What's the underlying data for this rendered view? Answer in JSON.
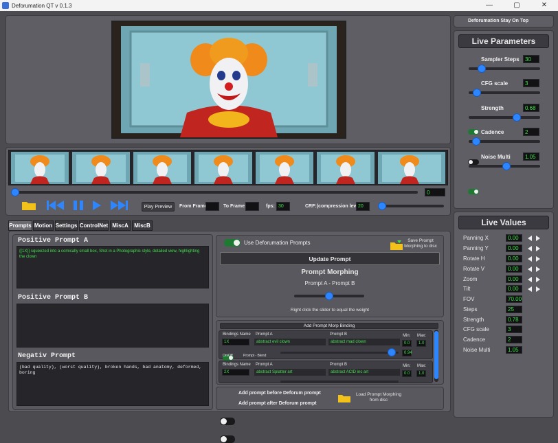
{
  "window": {
    "title": "Deforumation QT v 0.1.3",
    "minimize": "—",
    "maximize": "▢",
    "close": "✕"
  },
  "topbar": {
    "stay_on_top_label": "Deforumation Stay On Top"
  },
  "live_parameters": {
    "title": "Live Parameters",
    "items": [
      {
        "label": "Sampler Steps",
        "value": "30",
        "has_toggle": false,
        "slider_pct": 14
      },
      {
        "label": "CFG scale",
        "value": "3",
        "has_toggle": true,
        "toggle_on": true,
        "slider_pct": 6
      },
      {
        "label": "Strength",
        "value": "0.68",
        "has_toggle": true,
        "toggle_on": false,
        "slider_pct": 68
      },
      {
        "label": "Cadence",
        "value": "2",
        "has_toggle": true,
        "toggle_on": true,
        "slider_pct": 5
      },
      {
        "label": "Noise Multi",
        "value": "1.05",
        "has_toggle": true,
        "toggle_on": true,
        "slider_pct": 52
      }
    ]
  },
  "live_values": {
    "title": "Live Values",
    "items": [
      {
        "label": "Panning X",
        "value": "0.00",
        "arrows": true
      },
      {
        "label": "Panning Y",
        "value": "0.00",
        "arrows": true
      },
      {
        "label": "Rotate H",
        "value": "0.00",
        "arrows": true
      },
      {
        "label": "Rotate V",
        "value": "0.00",
        "arrows": true
      },
      {
        "label": "Zoom",
        "value": "0.00",
        "arrows": true
      },
      {
        "label": "Tilt",
        "value": "0.00",
        "arrows": true
      },
      {
        "label": "FOV",
        "value": "70.00",
        "arrows": false
      },
      {
        "label": "Steps",
        "value": "25",
        "arrows": false
      },
      {
        "label": "Strength",
        "value": "0.78",
        "arrows": false
      },
      {
        "label": "CFG scale",
        "value": "3",
        "arrows": false
      },
      {
        "label": "Cadence",
        "value": "2",
        "arrows": false
      },
      {
        "label": "Noise Multi",
        "value": "1.05",
        "arrows": false
      }
    ]
  },
  "playback": {
    "timeline_value": "0",
    "timeline_pct": 0,
    "play_preview": "Play Preview",
    "from_frame_label": "From Frame:",
    "from_frame_value": "",
    "to_frame_label": "To Frame:",
    "to_frame_value": "",
    "fps_label": "fps:",
    "fps_value": "30",
    "crf_label": "CRF:(compression level)",
    "crf_value": "20",
    "crf_pct": 0
  },
  "tabs": [
    "Prompts",
    "Motion",
    "Settings",
    "ControlNet",
    "MiscA",
    "MiscB"
  ],
  "prompts": {
    "positive_a_title": "Positive Prompt A",
    "positive_a_text": "{{1X}} squeezed into a comically small box, Shot in a Photographic style,  detailed view, highlighting the clown",
    "positive_b_title": "Positive Prompt B",
    "positive_b_text": "",
    "negative_title": "Negativ Prompt",
    "negative_text": "(bad quality), (worst quality), broken hands, bad anatomy, deformed, boring"
  },
  "morph": {
    "use_prompts_label": "Use Deforumation Prompts",
    "save_label": "Save Prompt Morphing to disc",
    "update_button": "Update Prompt",
    "title": "Prompt Morphing",
    "subtitle": "Prompt A - Prompt B",
    "slider_pct": 50,
    "hint": "Right click the slider to equal the weight",
    "add_binding": "Add Prompt Morp Binding",
    "bindings": [
      {
        "name_header": "Bindings Name",
        "a_header": "Prompt A",
        "b_header": "Prompt B",
        "min_header": "Min:",
        "max_header": "Max:",
        "name": "1X",
        "prompt_a": "abstract evil clown",
        "prompt_b": "abstract mad clown",
        "min": "0.0",
        "max": "1.0",
        "onoff": "On/Off",
        "blend": "Prompt - Blend",
        "weight": "0.94",
        "slider_pct": 94
      },
      {
        "name_header": "Bindings Name",
        "a_header": "Prompt A",
        "b_header": "Prompt B",
        "min_header": "Min:",
        "max_header": "Max:",
        "name": "2X",
        "prompt_a": "abstract Splatter art",
        "prompt_b": "abstract ACID inc art",
        "min": "0.0",
        "max": "1.0",
        "weight": "",
        "slider_pct": 50
      }
    ],
    "add_before": "Add prompt before Deforum prompt",
    "add_after": "Add prompt after Deforum prompt",
    "load_label": "Load Prompt Morphing from disc"
  },
  "colors": {
    "accent": "#2e86ff",
    "value_green": "#3fe04a",
    "panel": "#5e5e64",
    "background": "#4b4b50"
  }
}
